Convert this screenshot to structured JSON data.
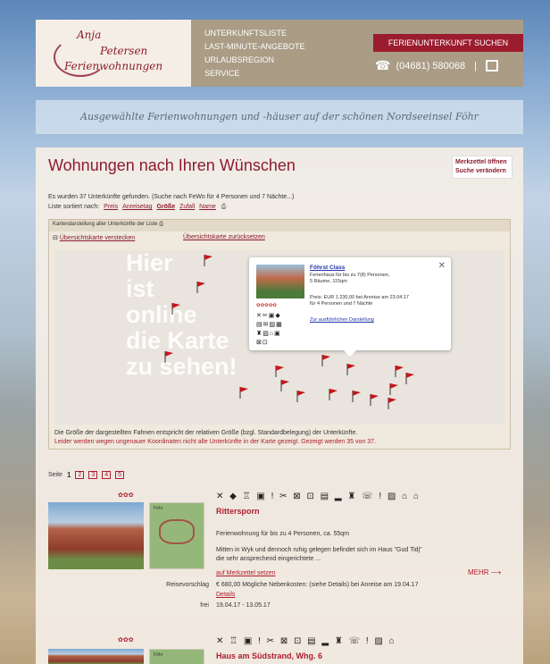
{
  "header": {
    "logo": {
      "line1": "Anja",
      "line2": "Petersen",
      "line3": "Ferienwohnungen"
    },
    "nav": [
      "UNTERKUNFTSLISTE",
      "LAST-MINUTE-ANGEBOTE",
      "URLAUBSREGION",
      "SERVICE"
    ],
    "cta": "FERIENUNTERKUNFT SUCHEN",
    "phone": "(04681) 580068",
    "phone_sep": "|"
  },
  "tagline": "Ausgewählte Ferienwohnungen und -häuser auf der schönen Nordseeinsel Föhr",
  "main": {
    "title": "Wohnungen nach Ihren Wünschen",
    "side": [
      "Merkzettel öffnen",
      "Suche verändern"
    ],
    "found": "Es wurden 37 Unterkünfte gefunden. (Suche nach FeWo für 4 Personen und 7 Nächte...)",
    "sort_label": "Liste sortiert nach:",
    "sort": [
      "Preis",
      "Anreisetag",
      "Größe",
      "Zufall",
      "Name"
    ]
  },
  "map": {
    "head": "Kartendarstellung aller Unterkünfte der Liste",
    "hide": "Übersichtskarte verstecken",
    "reset": "Übersichtskarte zurücksetzen",
    "placeholder": [
      "Hier",
      "ist",
      "online",
      "die Karte",
      "zu sehen!"
    ],
    "popup": {
      "name": "Föhrst Class",
      "desc1": "Ferienhaus für bis zu 7(8) Personen,",
      "desc2": "5 Räume, 115qm",
      "price1": "Preis: EUR 1.230,00 bei Anreise am 23.04.17",
      "price2": "für 4 Personen und 7 Nächte",
      "details": "Zur ausführlichen Darstellung"
    },
    "note": "Die Größe der dargestellten Fahnen entspricht der relativen Größe (bzgl. Standardbelegung) der Unterkünfte.",
    "warn": "Leider werden wegen ungenauer Koordinaten nicht alle Unterkünfte in der Karte gezeigt. Gezeigt werden 35 von 37."
  },
  "pager": {
    "label": "Seite",
    "current": "1",
    "pages": [
      "2",
      "3",
      "4",
      "5"
    ]
  },
  "listings": [
    {
      "stars": "✿✿✿",
      "icons": "✕ ◆ ♖ ▣ ! ✂ ⊠ ⊡ ▤ ▂ ♜ ☏ ! ▨ ⌂ ⌂",
      "thumb_label": "Föhr",
      "name": "Rittersporn",
      "desc1": "Ferienwohnung für bis zu 4 Personen, ca. 55qm",
      "desc2": "Mitten in Wyk und dennoch ruhig gelegen befindet sich im Haus \"Gud Tidj\"",
      "desc3": "die sehr ansprechend eingerichtete ...",
      "merk": "auf Merkzettel setzen",
      "mehr": "MEHR ⟶",
      "row1_label": "Reisevorschlag",
      "row1_val": "€ 680,00 Mögliche Nebenkosten: (siehe Details) bei Anreise am 19.04.17",
      "details": "Details",
      "row2_label": "frei",
      "row2_val": "19.04.17 - 13.05.17"
    },
    {
      "stars": "✿✿✿",
      "icons": "✕ ♖ ▣ ! ✂ ⊠ ⊡ ▤ ▂ ♜ ☏ ! ▨ ⌂",
      "thumb_label": "Föhr",
      "name": "Haus am Südstrand, Whg. 6"
    }
  ],
  "colors": {
    "accent": "#8c1c2c",
    "header": "#aa9c85"
  }
}
